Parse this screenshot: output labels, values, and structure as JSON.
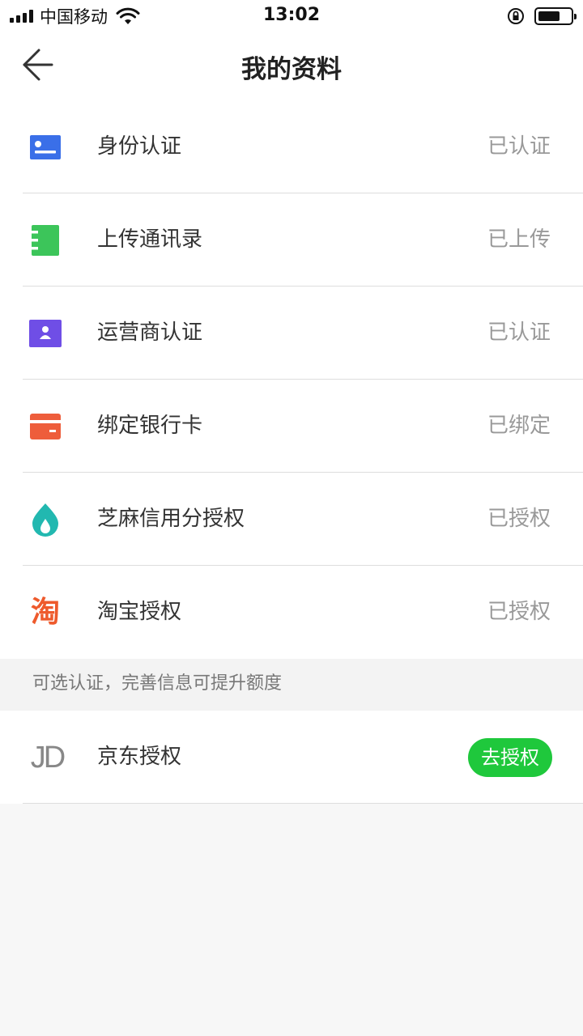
{
  "status_bar": {
    "carrier": "中国移动",
    "time": "13:02"
  },
  "header": {
    "title": "我的资料"
  },
  "items": [
    {
      "label": "身份认证",
      "status": "已认证",
      "icon": "id-card-icon",
      "color": "#3a6fe8"
    },
    {
      "label": "上传通讯录",
      "status": "已上传",
      "icon": "contacts-book-icon",
      "color": "#3cc55a"
    },
    {
      "label": "运营商认证",
      "status": "已认证",
      "icon": "operator-user-icon",
      "color": "#6f4ee6"
    },
    {
      "label": "绑定银行卡",
      "status": "已绑定",
      "icon": "bank-card-icon",
      "color": "#ee5d3b"
    },
    {
      "label": "芝麻信用分授权",
      "status": "已授权",
      "icon": "sesame-drop-icon",
      "color": "#22b8b0"
    },
    {
      "label": "淘宝授权",
      "status": "已授权",
      "icon": "taobao-icon",
      "color": "#ee5a2c",
      "icon_text": "淘"
    }
  ],
  "optional_tip": "可选认证，完善信息可提升额度",
  "optional_items": [
    {
      "label": "京东授权",
      "button": "去授权",
      "icon": "jd-logo-icon",
      "icon_text": "JD",
      "button_color": "#1fc83c"
    }
  ]
}
